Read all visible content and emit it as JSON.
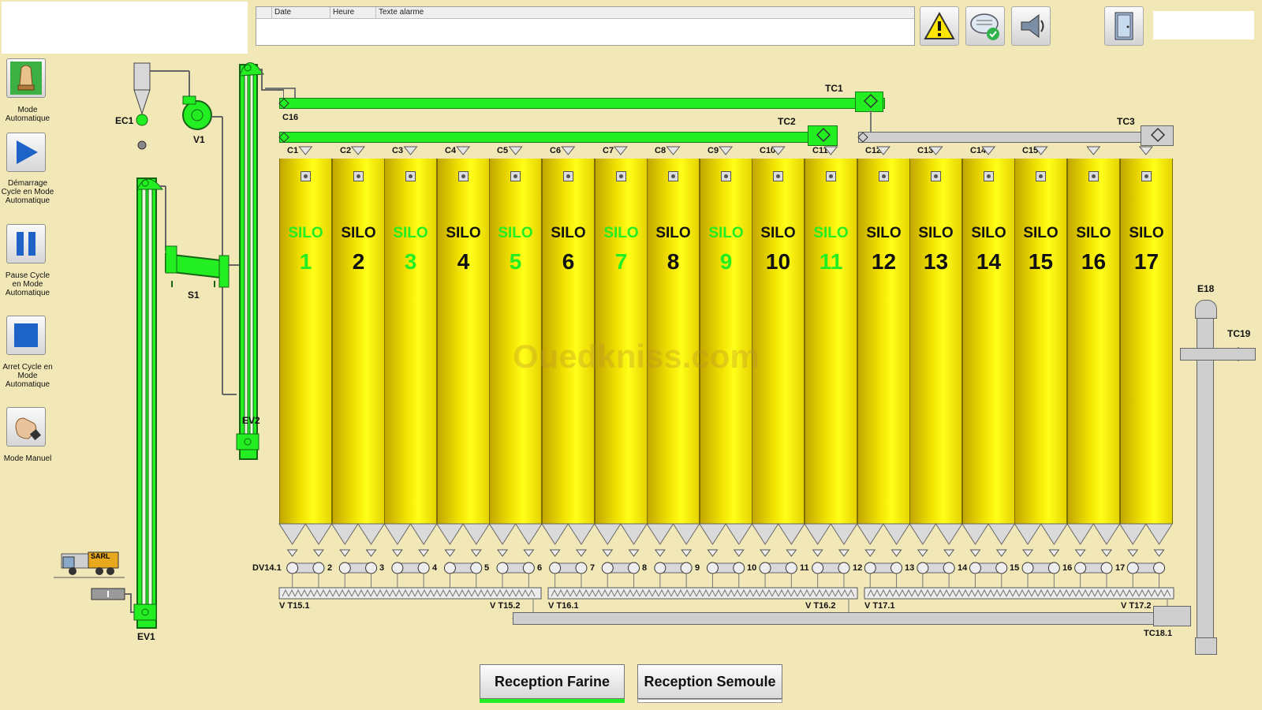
{
  "alarm_table": {
    "columns": [
      "Date",
      "Heure",
      "Texte alarme"
    ]
  },
  "toolbar": [
    {
      "label": "Mode Automatique",
      "icon": "hand-chess-icon"
    },
    {
      "label": "Démarrage Cycle en Mode Automatique",
      "icon": "play-icon"
    },
    {
      "label": "Pause Cycle en Mode Automatique",
      "icon": "pause-icon"
    },
    {
      "label": "Arret Cycle en Mode Automatique",
      "icon": "stop-icon"
    },
    {
      "label": "Mode Manuel",
      "icon": "hand-icon"
    }
  ],
  "top_icons": [
    "warning-icon",
    "acknowledge-message-icon",
    "alarm-horn-icon",
    "door-exit-icon"
  ],
  "equipment": {
    "ec1": "EC1",
    "v1": "V1",
    "s1": "S1",
    "ev1": "EV1",
    "ev2": "EV2",
    "tc1": "TC1",
    "tc2": "TC2",
    "tc3": "TC3",
    "c16": "C16",
    "e18": "E18",
    "tc19": "TC19",
    "tc18": "TC18.1",
    "truck": "SARL"
  },
  "silos": [
    {
      "word": "SILO",
      "number": "1",
      "active": true
    },
    {
      "word": "SILO",
      "number": "2",
      "active": false
    },
    {
      "word": "SILO",
      "number": "3",
      "active": true
    },
    {
      "word": "SILO",
      "number": "4",
      "active": false
    },
    {
      "word": "SILO",
      "number": "5",
      "active": true
    },
    {
      "word": "SILO",
      "number": "6",
      "active": false
    },
    {
      "word": "SILO",
      "number": "7",
      "active": true
    },
    {
      "word": "SILO",
      "number": "8",
      "active": false
    },
    {
      "word": "SILO",
      "number": "9",
      "active": true
    },
    {
      "word": "SILO",
      "number": "10",
      "active": false
    },
    {
      "word": "SILO",
      "number": "11",
      "active": true
    },
    {
      "word": "SILO",
      "number": "12",
      "active": false
    },
    {
      "word": "SILO",
      "number": "13",
      "active": false
    },
    {
      "word": "SILO",
      "number": "14",
      "active": false
    },
    {
      "word": "SILO",
      "number": "15",
      "active": false
    },
    {
      "word": "SILO",
      "number": "16",
      "active": false
    },
    {
      "word": "SILO",
      "number": "17",
      "active": false
    }
  ],
  "valve_labels": [
    "C1",
    "C2",
    "C3",
    "C4",
    "C5",
    "C6",
    "C7",
    "C8",
    "C9",
    "C10",
    "C11",
    "C12",
    "C13",
    "C14",
    "C15"
  ],
  "dv_labels": [
    "DV14.1",
    "2",
    "3",
    "4",
    "5",
    "6",
    "7",
    "8",
    "9",
    "10",
    "11",
    "12",
    "13",
    "14",
    "15",
    "16",
    "17"
  ],
  "screws": [
    {
      "start": "V T15.1",
      "end": "V T15.2"
    },
    {
      "start": "V T16.1",
      "end": "V T16.2"
    },
    {
      "start": "V T17.1",
      "end": "V T17.2"
    }
  ],
  "buttons": {
    "reception_farine": "Reception Farine",
    "reception_semoule": "Reception Semoule"
  },
  "watermark": "Ouedkniss.com",
  "colors": {
    "active_green": "#22ee22",
    "inactive_gray": "#cfcfcf",
    "silo_yellow": "#ffff19",
    "background": "#f2e8b7"
  }
}
